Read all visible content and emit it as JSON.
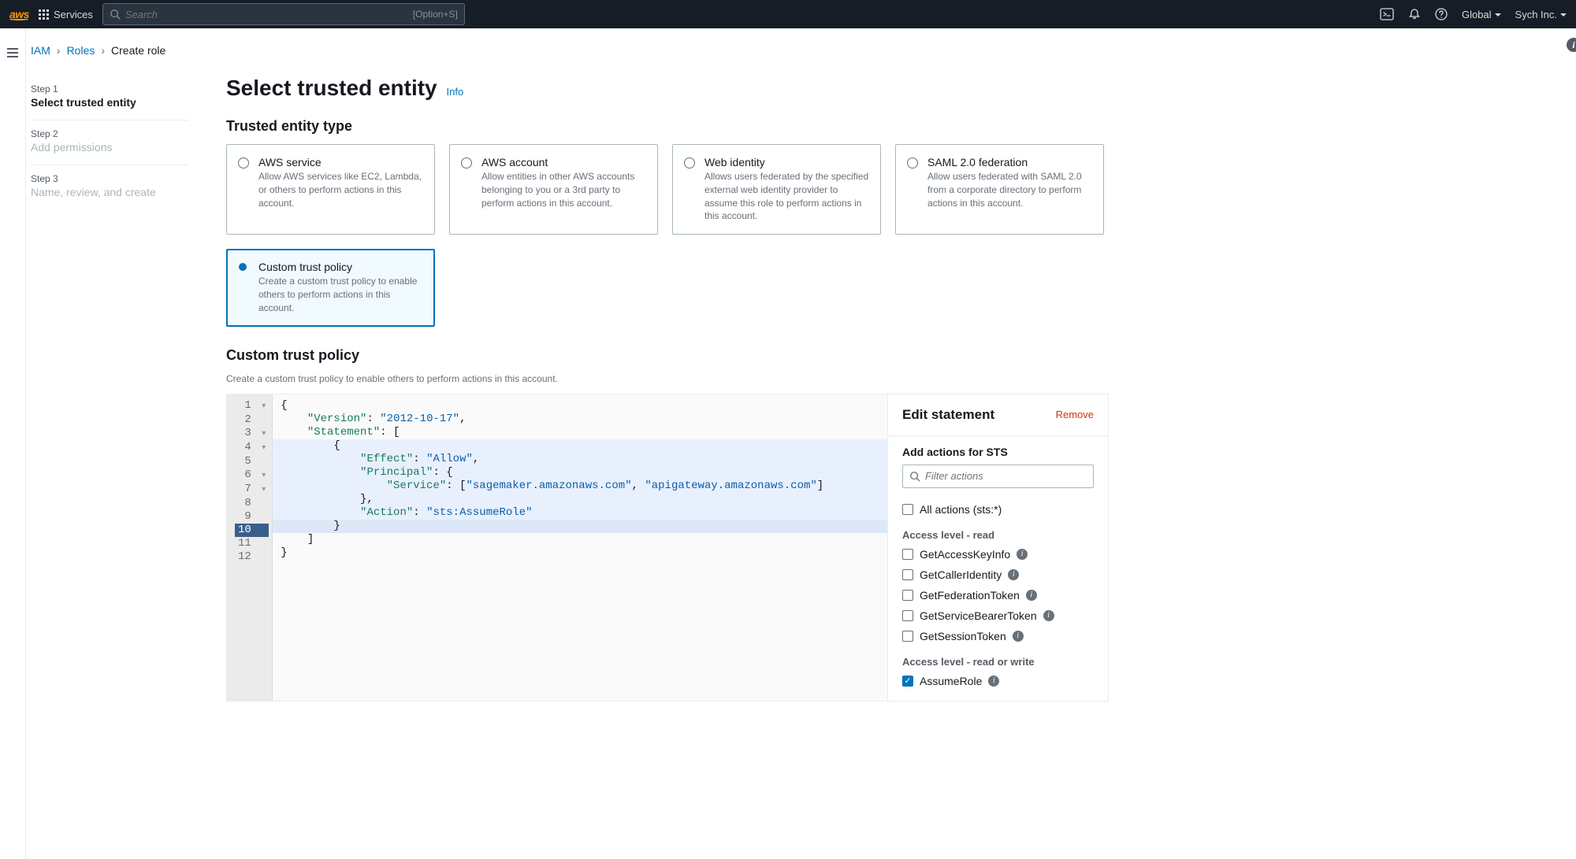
{
  "topnav": {
    "services": "Services",
    "search_placeholder": "Search",
    "search_hint": "[Option+S]",
    "region": "Global",
    "account": "Sych Inc."
  },
  "breadcrumb": {
    "root": "IAM",
    "roles": "Roles",
    "current": "Create role"
  },
  "steps": [
    {
      "label": "Step 1",
      "title": "Select trusted entity",
      "state": "active"
    },
    {
      "label": "Step 2",
      "title": "Add permissions",
      "state": "inactive"
    },
    {
      "label": "Step 3",
      "title": "Name, review, and create",
      "state": "inactive"
    }
  ],
  "heading": "Select trusted entity",
  "info_label": "Info",
  "section_trusted": "Trusted entity type",
  "entities": [
    {
      "title": "AWS service",
      "desc": "Allow AWS services like EC2, Lambda, or others to perform actions in this account."
    },
    {
      "title": "AWS account",
      "desc": "Allow entities in other AWS accounts belonging to you or a 3rd party to perform actions in this account."
    },
    {
      "title": "Web identity",
      "desc": "Allows users federated by the specified external web identity provider to assume this role to perform actions in this account."
    },
    {
      "title": "SAML 2.0 federation",
      "desc": "Allow users federated with SAML 2.0 from a corporate directory to perform actions in this account."
    },
    {
      "title": "Custom trust policy",
      "desc": "Create a custom trust policy to enable others to perform actions in this account."
    }
  ],
  "selected_entity_index": 4,
  "section_policy": {
    "title": "Custom trust policy",
    "desc": "Create a custom trust policy to enable others to perform actions in this account."
  },
  "code_lines": [
    "{",
    "    \"Version\": \"2012-10-17\",",
    "    \"Statement\": [",
    "        {",
    "            \"Effect\": \"Allow\",",
    "            \"Principal\": {",
    "                \"Service\": [\"sagemaker.amazonaws.com\", \"apigateway.amazonaws.com\"]",
    "            },",
    "            \"Action\": \"sts:AssumeRole\"",
    "        }",
    "    ]",
    "}"
  ],
  "folds": [
    1,
    3,
    4,
    6,
    7
  ],
  "highlight_start": 4,
  "current_line": 10,
  "side": {
    "title": "Edit statement",
    "remove": "Remove",
    "add_actions": "Add actions for STS",
    "filter_placeholder": "Filter actions",
    "all_actions": "All actions (sts:*)",
    "level_read": "Access level - read",
    "read_actions": [
      "GetAccessKeyInfo",
      "GetCallerIdentity",
      "GetFederationToken",
      "GetServiceBearerToken",
      "GetSessionToken"
    ],
    "level_rw": "Access level - read or write",
    "rw_actions": [
      {
        "name": "AssumeRole",
        "checked": true
      }
    ]
  }
}
